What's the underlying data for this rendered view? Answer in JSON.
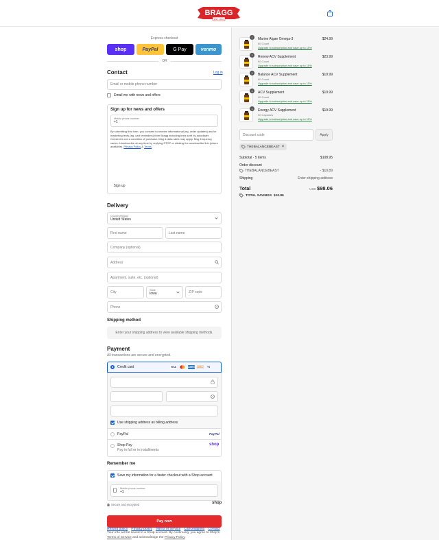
{
  "brand": {
    "name": "BRAGG",
    "est": "EST. 1912",
    "logo_color": "#d9262b"
  },
  "express": {
    "title": "Express checkout",
    "buttons": [
      {
        "label": "shop",
        "color": "#5a31f4"
      },
      {
        "label": "PayPal",
        "color": "#ffc439"
      },
      {
        "label": "G Pay",
        "color": "#000000"
      },
      {
        "label": "venmo",
        "color": "#3d95ce"
      }
    ],
    "or": "OR"
  },
  "contact": {
    "heading": "Contact",
    "login": "Log in",
    "email_placeholder": "Email or mobile phone number",
    "newsletter_label": "Email me with news and offers"
  },
  "sms": {
    "heading": "Sign up for news and offers",
    "phone_label": "Mobile phone number",
    "phone_value": "+1",
    "consent": "By submitting this form, you consent to receive informational (eg, order updates) and/or marketing texts (eg, cart reminders) from Bragg including texts sent by autodialer. Consent is not a condition of purchase. Msg & data rates may apply. Msg frequency varies. Unsubscribe at any time by replying STOP or clicking the unsubscribe link (where available).",
    "privacy": "Privacy Policy",
    "amp": "&",
    "terms": "Terms",
    "button": "Sign up"
  },
  "delivery": {
    "heading": "Delivery",
    "country_label": "Country/Region",
    "country_value": "United States",
    "first_name": "First name",
    "last_name": "Last name",
    "company": "Company (optional)",
    "address": "Address",
    "apartment": "Apartment, suite, etc. (optional)",
    "city": "City",
    "state_label": "State",
    "state_value": "Iowa",
    "zip": "ZIP code",
    "phone": "Phone"
  },
  "shipping_method": {
    "heading": "Shipping method",
    "message": "Enter your shipping address to view available shipping methods."
  },
  "payment": {
    "heading": "Payment",
    "subtitle": "All transactions are secure and encrypted.",
    "credit_card": "Credit card",
    "card_brands": [
      "VISA",
      "MC",
      "AMEX",
      "DISC"
    ],
    "more_brands": "+4",
    "billing_label": "Use shipping address as billing address",
    "paypal": "PayPal",
    "shop_pay": "Shop Pay",
    "shop_pay_sub": "Pay in full or in installments",
    "shop_logo": "shop"
  },
  "remember": {
    "heading": "Remember me",
    "checkbox_label": "Save my information for a faster checkout with a Shop account",
    "phone_label": "Mobile phone number",
    "phone_value": "+1",
    "secure": "Secure and encrypted",
    "shop_logo": "shop"
  },
  "pay_now": "Pay now",
  "legal": {
    "text1": "Your info will be saved to a Shop account. By continuing, you agree to Shop's",
    "terms": "Terms of Service",
    "text2": "and acknowledge the",
    "privacy": "Privacy Policy",
    "period": "."
  },
  "footer": [
    "Refund policy",
    "Privacy policy",
    "Terms of service",
    "Cancellations",
    "Contact"
  ],
  "products": [
    {
      "qty": "1",
      "name": "Marine Algae Omega-3",
      "desc": "60 Count",
      "upgrade": "Upgrade to subscription and save up to 15%",
      "price": "$24.99"
    },
    {
      "qty": "1",
      "name": "Renew ACV Supplement",
      "desc": "90 Count",
      "upgrade": "Upgrade to subscription and save up to 15%",
      "price": "$23.99"
    },
    {
      "qty": "1",
      "name": "Balance ACV Supplement",
      "desc": "90 Count",
      "upgrade": "Upgrade to subscription and save up to 15%",
      "price": "$19.99"
    },
    {
      "qty": "1",
      "name": "ACV Supplement",
      "desc": "90 Count",
      "upgrade": "Upgrade to subscription and save up to 15%",
      "price": "$19.99"
    },
    {
      "qty": "1",
      "name": "Energy ACV Supplement",
      "desc": "90 Capsules",
      "upgrade": "Upgrade to subscription and save up to 15%",
      "price": "$19.99"
    }
  ],
  "discount": {
    "placeholder": "Discount code",
    "apply": "Apply",
    "tag": "THEBALANCEBEAST"
  },
  "summary": {
    "subtotal_label": "Subtotal · 5 items",
    "subtotal": "$108.95",
    "order_discount": "Order discount",
    "code": "THEBALANCEBEAST",
    "discount_amount": "- $10.89",
    "shipping_label": "Shipping",
    "shipping_value": "Enter shipping address",
    "total_label": "Total",
    "currency": "USD",
    "total": "$98.06",
    "savings_label": "TOTAL SAVINGS",
    "savings": "$10.89"
  }
}
